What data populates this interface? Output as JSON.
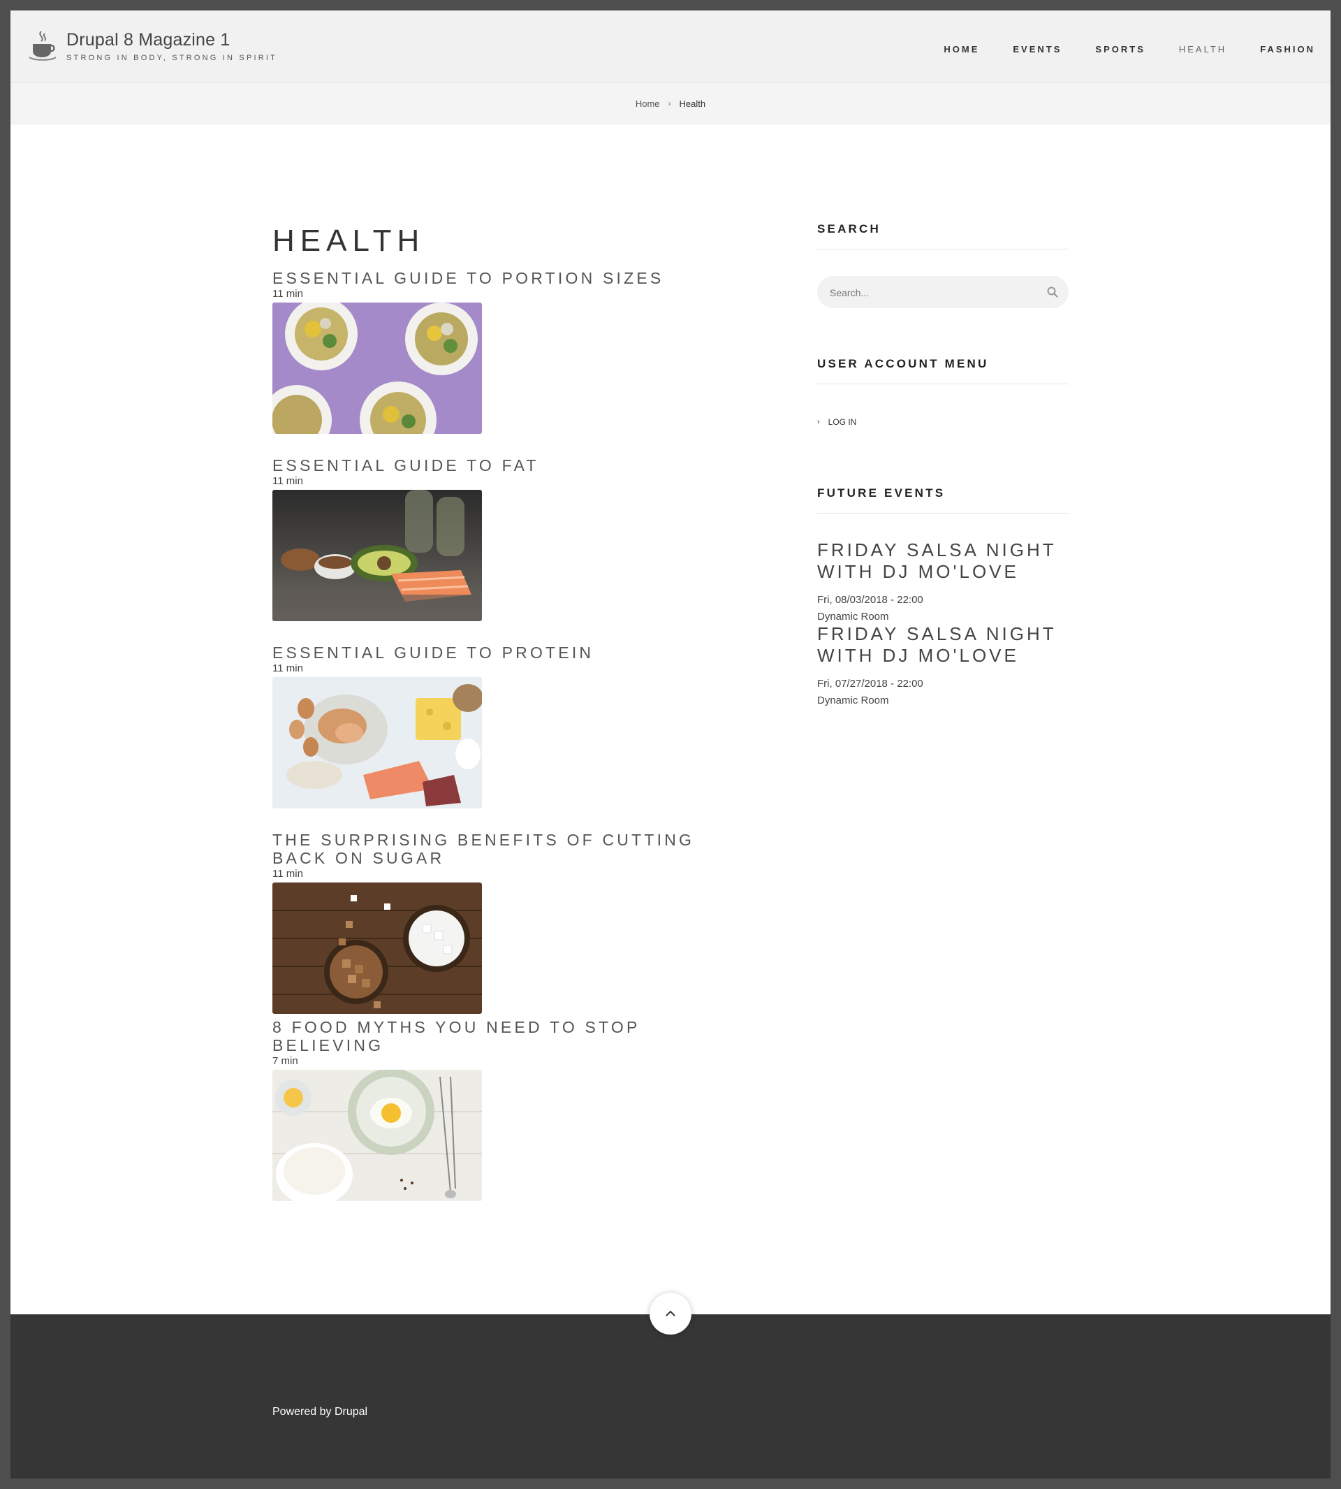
{
  "site": {
    "name": "Drupal 8 Magazine 1",
    "slogan": "STRONG IN BODY, STRONG IN SPIRIT",
    "logo_icon": "coffee-cup-icon"
  },
  "nav": {
    "items": [
      {
        "label": "HOME"
      },
      {
        "label": "EVENTS"
      },
      {
        "label": "SPORTS"
      },
      {
        "label": "HEALTH",
        "active": true
      },
      {
        "label": "FASHION"
      }
    ]
  },
  "breadcrumb": {
    "home": "Home",
    "separator": "›",
    "current": "Health"
  },
  "page": {
    "title": "HEALTH"
  },
  "articles": [
    {
      "title": "ESSENTIAL GUIDE TO PORTION SIZES",
      "read_time": "11 min",
      "image": "salad-bowls"
    },
    {
      "title": "ESSENTIAL GUIDE TO FAT",
      "read_time": "11 min",
      "image": "avocado-salmon"
    },
    {
      "title": "ESSENTIAL GUIDE TO PROTEIN",
      "read_time": "11 min",
      "image": "eggs-cheese-salmon"
    },
    {
      "title": "THE SURPRISING BENEFITS OF CUTTING BACK ON SUGAR",
      "read_time": "11 min",
      "image": "sugar-cubes"
    },
    {
      "title": "8 FOOD MYTHS YOU NEED TO STOP BELIEVING",
      "read_time": "7 min",
      "image": "egg-bowl-milk"
    }
  ],
  "sidebar": {
    "search": {
      "title": "SEARCH",
      "placeholder": "Search...",
      "icon": "search-icon"
    },
    "account": {
      "title": "USER ACCOUNT MENU",
      "login_label": "LOG IN"
    },
    "events": {
      "title": "FUTURE EVENTS",
      "items": [
        {
          "title": "FRIDAY SALSA NIGHT WITH DJ MO'LOVE",
          "date": "Fri, 08/03/2018 - 22:00",
          "location": "Dynamic Room"
        },
        {
          "title": "FRIDAY SALSA NIGHT WITH DJ MO'LOVE",
          "date": "Fri, 07/27/2018 - 22:00",
          "location": "Dynamic Room"
        }
      ]
    }
  },
  "footer": {
    "powered_by": "Powered by Drupal"
  },
  "colors": {
    "outer_border": "#4e4e4e",
    "header_bg": "#f1f1f1",
    "footer_bg": "#363636"
  }
}
